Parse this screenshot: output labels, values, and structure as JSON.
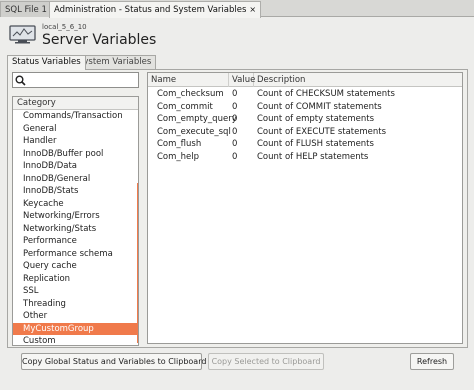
{
  "doc_tabs": [
    {
      "label": "SQL File 1",
      "close": "×"
    },
    {
      "label": "Administration - Status and System Variables",
      "close": "×"
    }
  ],
  "header": {
    "connection": "local_5_6_10",
    "title": "Server Variables",
    "icon": "monitor-icon"
  },
  "page_tabs": [
    "Status Variables",
    "System Variables"
  ],
  "search": {
    "value": "",
    "placeholder": "",
    "icon": "search-icon"
  },
  "category": {
    "header": "Category",
    "items": [
      "Commands/Transaction",
      "General",
      "Handler",
      "InnoDB/Buffer pool",
      "InnoDB/Data",
      "InnoDB/General",
      "InnoDB/Stats",
      "Keycache",
      "Networking/Errors",
      "Networking/Stats",
      "Performance",
      "Performance schema",
      "Query cache",
      "Replication",
      "SSL",
      "Threading",
      "Other",
      "MyCustomGroup",
      "Custom"
    ],
    "selected": "MyCustomGroup"
  },
  "grid": {
    "columns": [
      "Name",
      "Value",
      "Description"
    ],
    "rows": [
      [
        "Com_checksum",
        "0",
        "Count of CHECKSUM statements"
      ],
      [
        "Com_commit",
        "0",
        "Count of COMMIT statements"
      ],
      [
        "Com_empty_query",
        "0",
        "Count of empty statements"
      ],
      [
        "Com_execute_sql",
        "0",
        "Count of EXECUTE statements"
      ],
      [
        "Com_flush",
        "0",
        "Count of FLUSH statements"
      ],
      [
        "Com_help",
        "0",
        "Count of HELP statements"
      ]
    ]
  },
  "buttons": {
    "copy_all": "Copy Global Status and Variables to Clipboard",
    "copy_selected": "Copy Selected to Clipboard",
    "refresh": "Refresh"
  },
  "colors": {
    "selection": "#f07a4b",
    "background": "#ededeb"
  }
}
